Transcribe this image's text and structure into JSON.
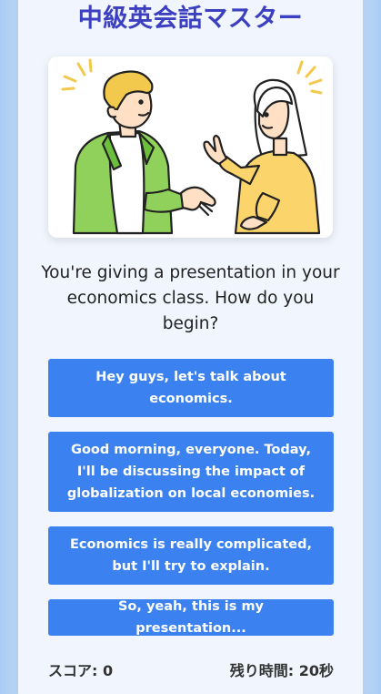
{
  "app": {
    "title": "中級英会話マスター"
  },
  "question": {
    "text": "You're giving a presentation in your economics class. How do you begin?"
  },
  "options": [
    {
      "label": "Hey guys, let's talk about economics."
    },
    {
      "label": "Good morning, everyone. Today, I'll be discussing the impact of globalization on local economies."
    },
    {
      "label": "Economics is really complicated, but I'll try to explain."
    },
    {
      "label": "So, yeah, this is my presentation..."
    }
  ],
  "status": {
    "score_label": "スコア: 0",
    "time_label": "残り時間: 20秒"
  },
  "colors": {
    "title": "#3b3fc0",
    "button": "#3b82f0",
    "card": "#f1f6fe"
  }
}
